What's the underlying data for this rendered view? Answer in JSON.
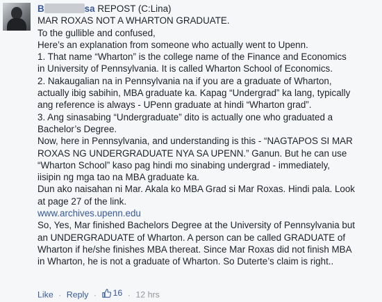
{
  "comment": {
    "author_prefix": "B",
    "author_suffix": "sa",
    "repost_note": "REPOST (C:Lina)",
    "lines": [
      "MAR ROXAS NOT A WHARTON GRADUATE.",
      "To the gullible and confused,",
      "Here’s an explanation from someone who actually went to Upenn.",
      "1. That name “Wharton” is the college name of the Finance and Economics",
      "in University of Pennsylvania. It is called Wharton School of Economics.",
      "2. Nakaugalian na in Pennsylvania na if you are a graduate of Wharton,",
      "actually ibig sabihin, MBA graduate ka. Kapag “Undergrad” ka lang, typically",
      "ang reference is always - UPenn graduate at hindi “Wharton grad”.",
      "3. Ang sinasabing “Undergraduate” dito is actually one who graduated a",
      "Bachelor’s Degree.",
      "Now, here in Pennsylvania, and understanding is this - “NAGTAPOS SI MAR",
      "ROXAS NG UNDERGRADUATE NYA SA UPENN.” Ganun. But he can use",
      "“Wharton School” kaso pag hindi mo sinabing undergrad - immediately,",
      "iisipin ng mga tao na MBA graduate ka.",
      "Dun ako naisahan ni Mar. Akala ko MBA Grad si Mar Roxas. Hindi pala. Look",
      "at page 27 of the link."
    ],
    "link_text": "www.archives.upenn.edu",
    "lines_after": [
      "So, Yes, Mar finished Bachelors Degree at the University of Pennsylvania but",
      "an UNDERGRADUATE of Wharton. A person can be called GRADUATE of",
      "Wharton if he/she finishes MBA thereat. Since Mar Roxas did not finish MBA",
      "in Wharton, he is not a graduate of Wharton. So Duterte’s claim is right.."
    ]
  },
  "actions": {
    "like_label": "Like",
    "separator": "·",
    "reply_label": "Reply",
    "like_count": "16",
    "timestamp": "12 hrs"
  },
  "colors": {
    "link": "#365899",
    "text": "#1d2129",
    "muted": "#90949c",
    "background": "#f6f7f9"
  },
  "icons": {
    "avatar": "profile-photo",
    "like_count": "thumbs-up-icon"
  }
}
